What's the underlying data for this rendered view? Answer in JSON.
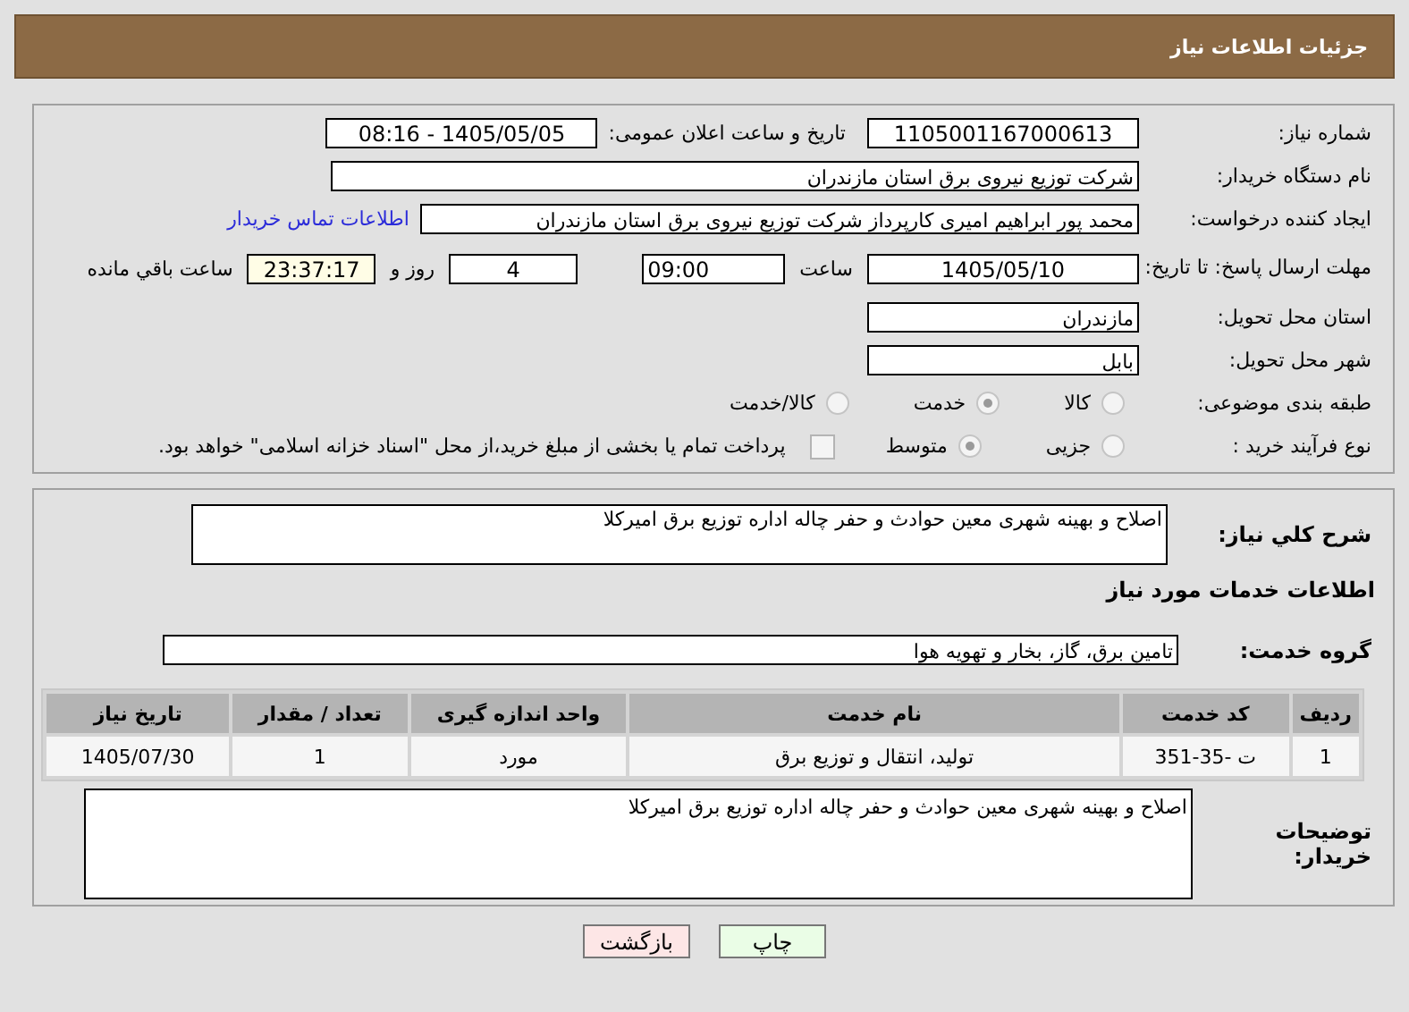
{
  "header": {
    "title": "جزئیات اطلاعات نیاز"
  },
  "details": {
    "need_number": {
      "label": "شماره نیاز:",
      "value": "1105001167000613"
    },
    "announce": {
      "label": "تاریخ و ساعت اعلان عمومی:",
      "value": "1405/05/05 - 08:16"
    },
    "buyer_org": {
      "label": "نام دستگاه خریدار:",
      "value": "شرکت توزیع نیروی برق استان مازندران"
    },
    "requester": {
      "label": "ایجاد کننده درخواست:",
      "value": "محمد پور ابراهیم امیری کارپرداز شرکت توزیع نیروی برق استان مازندران",
      "link": "اطلاعات تماس خریدار"
    },
    "deadline": {
      "label": "مهلت ارسال پاسخ: تا تاریخ:",
      "date": "1405/05/10",
      "time_label": "ساعت",
      "time": "09:00",
      "days": "4",
      "days_label": "روز و",
      "remaining": "23:37:17",
      "remaining_label": "ساعت باقي مانده"
    },
    "province": {
      "label": "استان محل تحویل:",
      "value": "مازندران"
    },
    "city": {
      "label": "شهر محل تحویل:",
      "value": "بابل"
    },
    "category": {
      "label": "طبقه بندی موضوعی:",
      "options": [
        {
          "label": "کالا",
          "selected": false
        },
        {
          "label": "خدمت",
          "selected": true
        },
        {
          "label": "کالا/خدمت",
          "selected": false
        }
      ]
    },
    "purchase_type": {
      "label": "نوع فرآیند خرید :",
      "options": [
        {
          "label": "جزیی",
          "selected": false
        },
        {
          "label": "متوسط",
          "selected": true
        }
      ],
      "payment_checked": false,
      "payment_note": "پرداخت تمام یا بخشی از مبلغ خرید،از محل \"اسناد خزانه اسلامی\" خواهد بود."
    }
  },
  "description": {
    "label": "شرح کلي نياز:",
    "value": "اصلاح و بهینه شهری معین حوادث و حفر چاله  اداره توزیع  برق امیرکلا"
  },
  "services_title": "اطلاعات خدمات مورد نياز",
  "service_group": {
    "label": "گروه خدمت:",
    "value": "تامین برق، گاز، بخار و تهویه هوا"
  },
  "table": {
    "columns": [
      "ردیف",
      "کد خدمت",
      "نام خدمت",
      "واحد اندازه گیری",
      "تعداد / مقدار",
      "تاریخ نیاز"
    ],
    "rows": [
      [
        "1",
        "ت -35-351",
        "تولید، انتقال و توزیع برق",
        "مورد",
        "1",
        "1405/07/30"
      ]
    ]
  },
  "buyer_notes": {
    "label": "توضیحات خریدار:",
    "value": "اصلاح و بهینه شهری معین حوادث و حفر چاله  اداره توزیع  برق امیرکلا"
  },
  "buttons": [
    {
      "kind": "print",
      "label": "چاپ"
    },
    {
      "kind": "back",
      "label": "بازگشت"
    }
  ]
}
